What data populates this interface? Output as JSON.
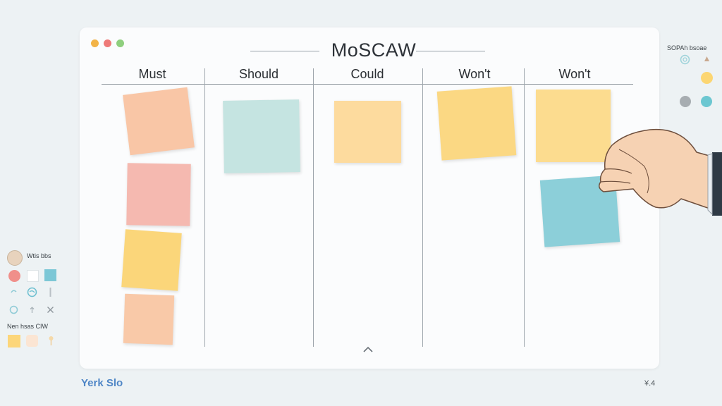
{
  "board": {
    "title": "MoSCAW",
    "window_dots": [
      "#f2b347",
      "#ee7a78",
      "#8fcf7e"
    ],
    "columns": [
      {
        "label": "Must"
      },
      {
        "label": "Should"
      },
      {
        "label": "Could"
      },
      {
        "label": "Won't"
      },
      {
        "label": "Won't"
      }
    ],
    "notes": [
      {
        "column": "Must",
        "color": "#f9c6a6"
      },
      {
        "column": "Must",
        "color": "#f5b9b0"
      },
      {
        "column": "Must",
        "color": "#fbd67a"
      },
      {
        "column": "Must",
        "color": "#f9c9a8"
      },
      {
        "column": "Should",
        "color": "#c5e4e1"
      },
      {
        "column": "Could",
        "color": "#fddb9e"
      },
      {
        "column": "Won't",
        "color": "#fbd883"
      },
      {
        "column": "Won't",
        "color": "#fcdc8f"
      },
      {
        "column": "Won't",
        "color": "#8ccfd9"
      }
    ]
  },
  "right_panel": {
    "label": "SOPAh bsoae",
    "icons": [
      "spiral-icon",
      "arrow-up-icon",
      "yellow-dot",
      "gray-dot",
      "teal-dot"
    ],
    "colors": {
      "yellow": "#fcd672",
      "gray": "#a7adb1",
      "teal": "#6cc7d1"
    }
  },
  "left_panel": {
    "label_top": "Wtis bbs",
    "label_bottom": "Nen hsas CIW",
    "icons": [
      "avatar",
      "red-circle",
      "white-square",
      "teal-square",
      "swirl-icon",
      "swirl-icon-2",
      "pencil-icon",
      "swirl-icon-3",
      "arrow-icon",
      "close-icon",
      "yellow-swatch",
      "peach-swatch",
      "pin-icon"
    ]
  },
  "footer": {
    "logo": "Yerk Slo",
    "right_text": "¥.4"
  }
}
